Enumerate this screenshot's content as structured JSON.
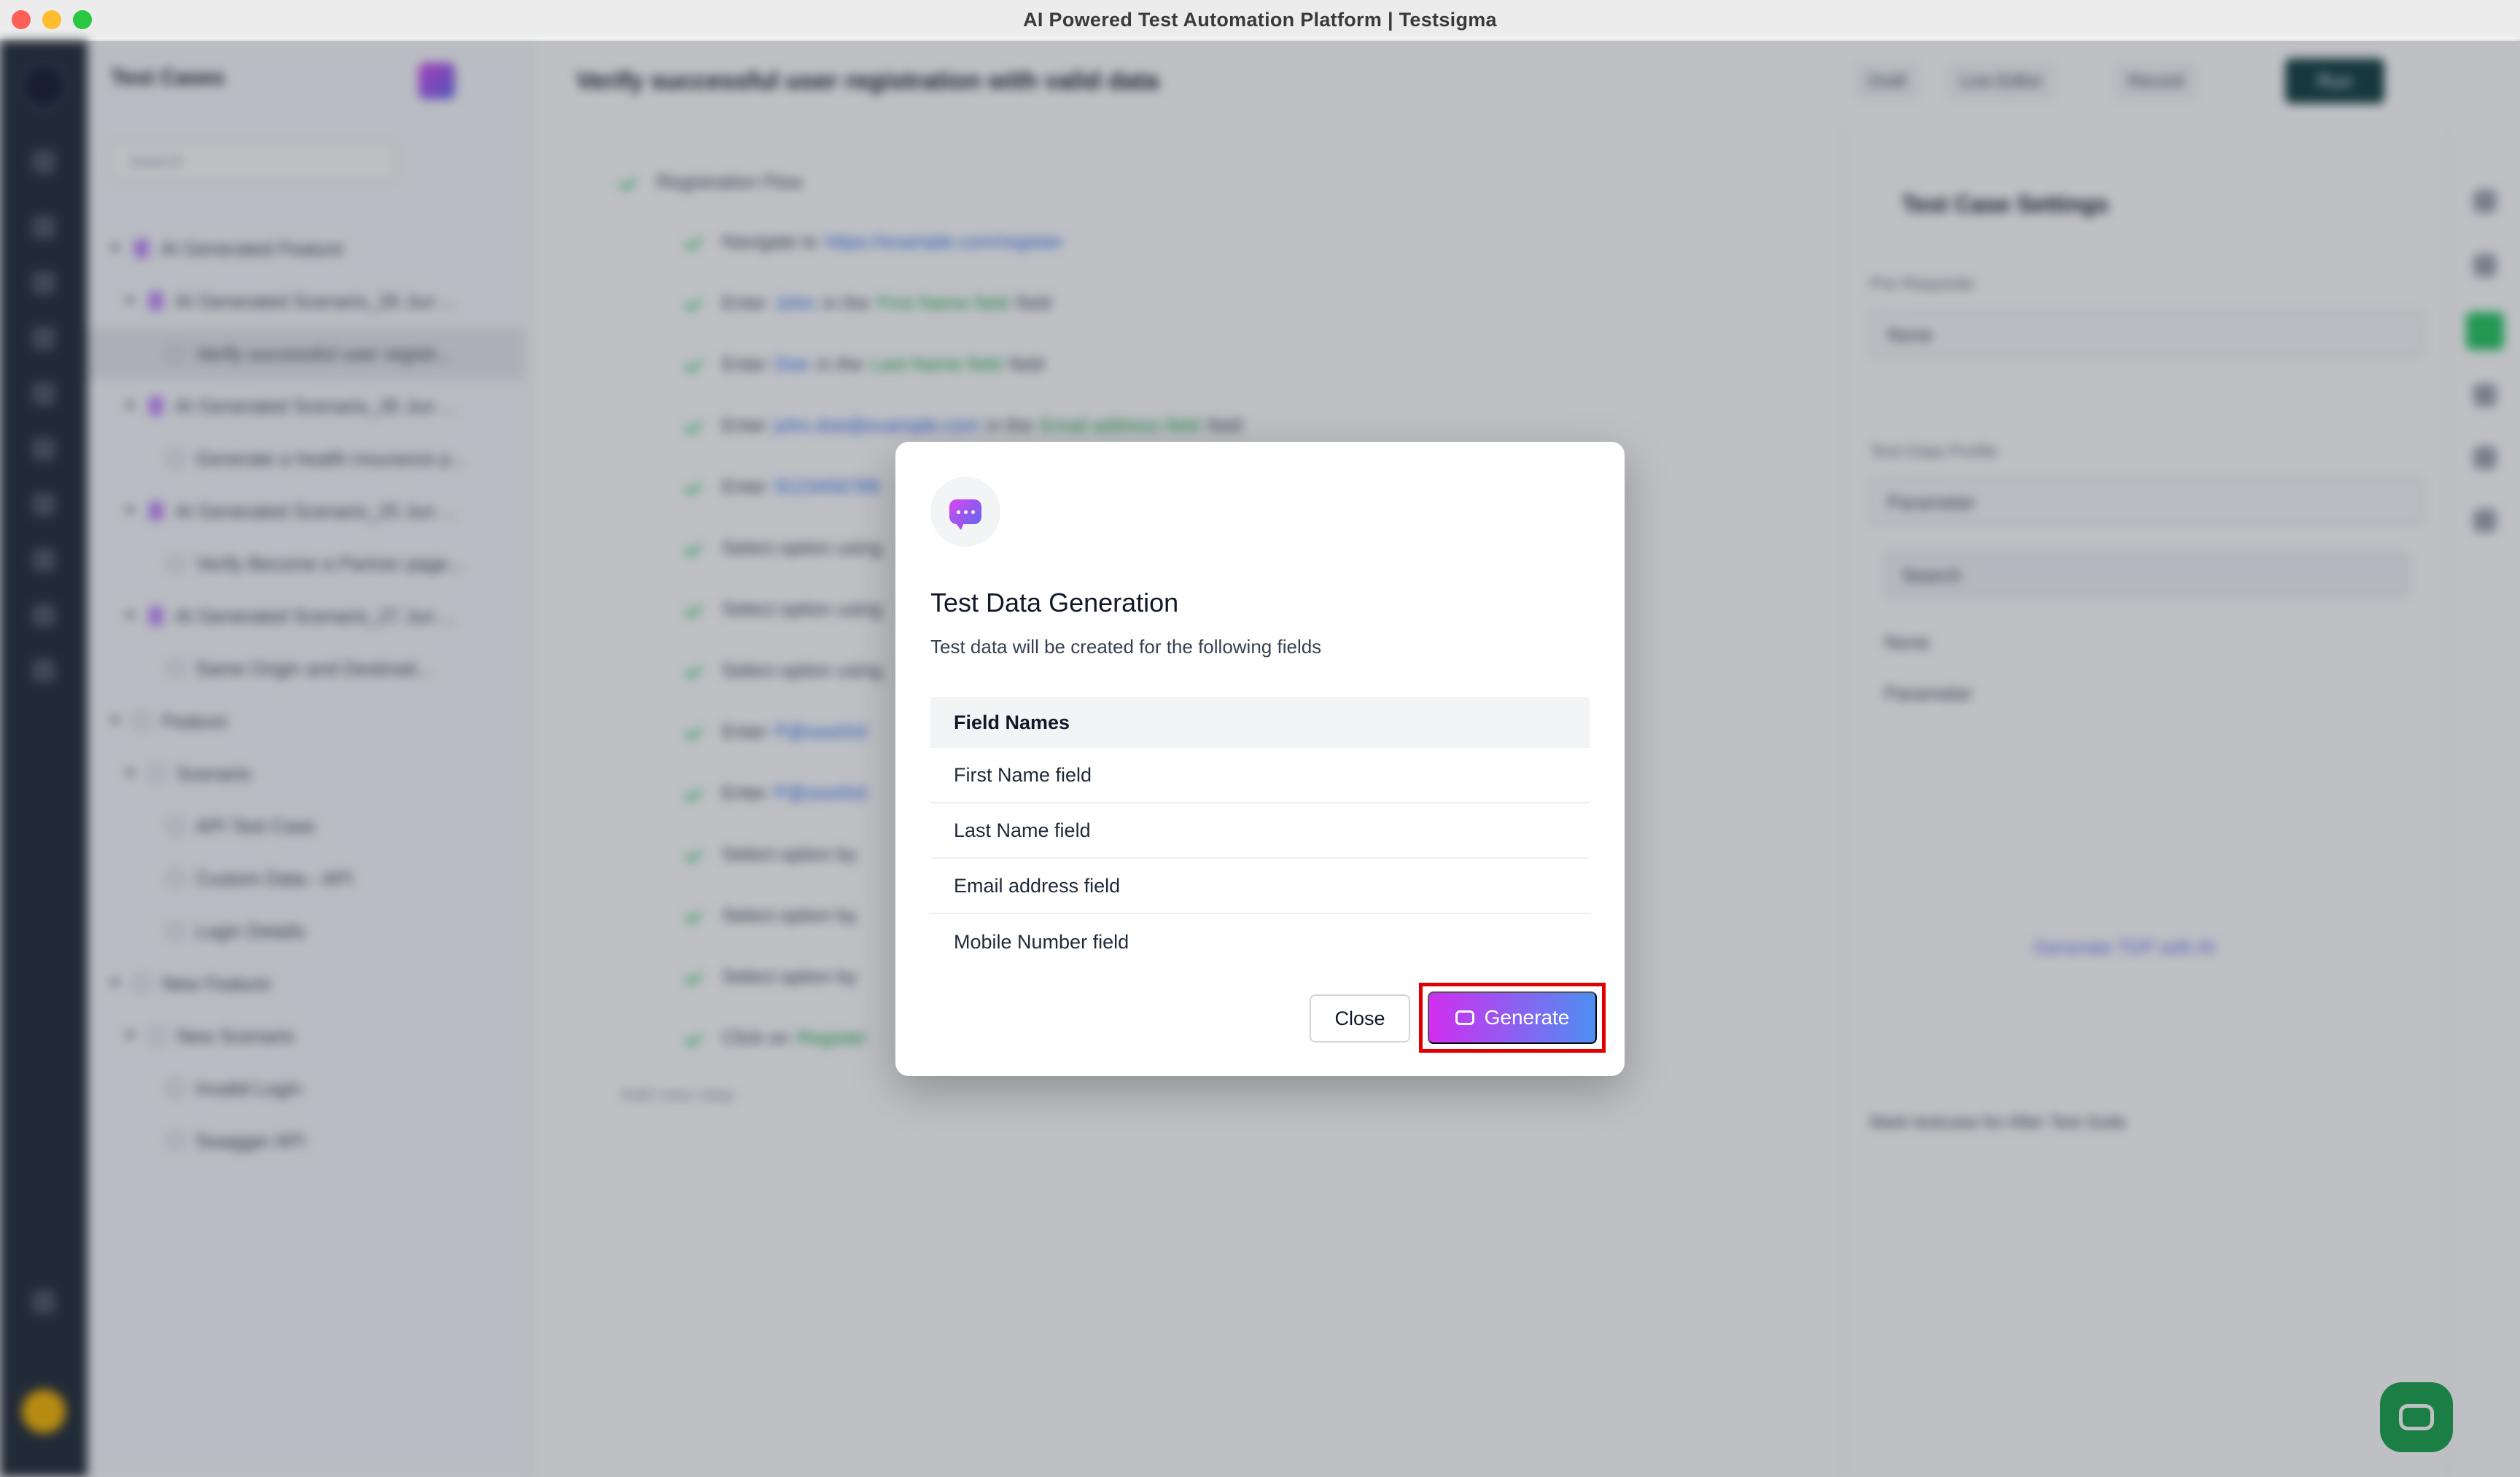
{
  "window": {
    "title": "AI Powered Test Automation Platform | Testsigma"
  },
  "tree": {
    "title": "Test Cases",
    "search_placeholder": "Search",
    "items": [
      {
        "label": "AI Generated Feature"
      },
      {
        "label": "AI Generated Scenario_26 Jun ..."
      },
      {
        "label": "Verify successful user registr..."
      },
      {
        "label": "AI Generated Scenario_26 Jun ..."
      },
      {
        "label": "Generate a health insurance p..."
      },
      {
        "label": "AI Generated Scenario_25 Jun ..."
      },
      {
        "label": "Verify Become a Partner page..."
      },
      {
        "label": "AI Generated Scenario_27 Jun ..."
      },
      {
        "label": "Same Origin and Destinati..."
      },
      {
        "label": "Feature"
      },
      {
        "label": "Scenario"
      },
      {
        "label": "API Test Case"
      },
      {
        "label": "Custom Data - API"
      },
      {
        "label": "Login Details"
      },
      {
        "label": "New Feature"
      },
      {
        "label": "New Scenario"
      },
      {
        "label": "Invalid Login"
      },
      {
        "label": "Swagger API"
      }
    ]
  },
  "main": {
    "title": "Verify successful user registration with valid data",
    "group_label": "Registration Flow",
    "steps": [
      {
        "prefix": "Navigate to",
        "link": "https://example.com/register",
        "mid": "",
        "field": "",
        "suffix": ""
      },
      {
        "prefix": "Enter",
        "link": "John",
        "mid": "in the",
        "field": "First Name field",
        "suffix": "field"
      },
      {
        "prefix": "Enter",
        "link": "Doe",
        "mid": "in the",
        "field": "Last Name field",
        "suffix": "field"
      },
      {
        "prefix": "Enter",
        "link": "john.doe@example.com",
        "mid": "in the",
        "field": "Email address field",
        "suffix": "field"
      },
      {
        "prefix": "Enter",
        "link": "9123456789",
        "mid": "",
        "field": "",
        "suffix": ""
      },
      {
        "prefix": "Select option using",
        "link": "",
        "mid": "",
        "field": "",
        "suffix": ""
      },
      {
        "prefix": "Select option using",
        "link": "",
        "mid": "",
        "field": "",
        "suffix": ""
      },
      {
        "prefix": "Select option using",
        "link": "",
        "mid": "",
        "field": "",
        "suffix": ""
      },
      {
        "prefix": "Enter",
        "link": "P@ssw0rd",
        "mid": "",
        "field": "",
        "suffix": ""
      },
      {
        "prefix": "Enter",
        "link": "P@ssw0rd",
        "mid": "",
        "field": "",
        "suffix": ""
      },
      {
        "prefix": "Select option by",
        "link": "",
        "mid": "",
        "field": "",
        "suffix": ""
      },
      {
        "prefix": "Select option by",
        "link": "",
        "mid": "",
        "field": "",
        "suffix": ""
      },
      {
        "prefix": "Select option by",
        "link": "",
        "mid": "",
        "field": "",
        "suffix": ""
      },
      {
        "prefix": "Click on",
        "link": "",
        "mid": "",
        "field": "Register",
        "suffix": ""
      }
    ],
    "add_step": "Add new step"
  },
  "topbar": {
    "draft": "Draft",
    "live_editor": "Live Editor",
    "record": "Record",
    "run": "Run"
  },
  "settings": {
    "title": "Test Case Settings",
    "prereq_label": "Pre Requisite",
    "prereq_value": "None",
    "tdp_label": "Test Data Profile",
    "tdp_value": "Parameter",
    "tdp_search": "Search",
    "tdp_opt1": "None",
    "tdp_opt2": "Parameter",
    "generate_tdp": "Generate TDP with AI",
    "mark_reuse": "Mark testcase for After Test Suite"
  },
  "modal": {
    "title": "Test Data Generation",
    "subtitle": "Test data will be created for the following fields",
    "table_header": "Field Names",
    "fields": [
      "First Name field",
      "Last Name field",
      "Email address field",
      "Mobile Number field"
    ],
    "close_label": "Close",
    "generate_label": "Generate"
  },
  "colors": {
    "highlight": "#e00000",
    "generate_gradient_start": "#d02ef0",
    "generate_gradient_end": "#4d8ff2"
  }
}
